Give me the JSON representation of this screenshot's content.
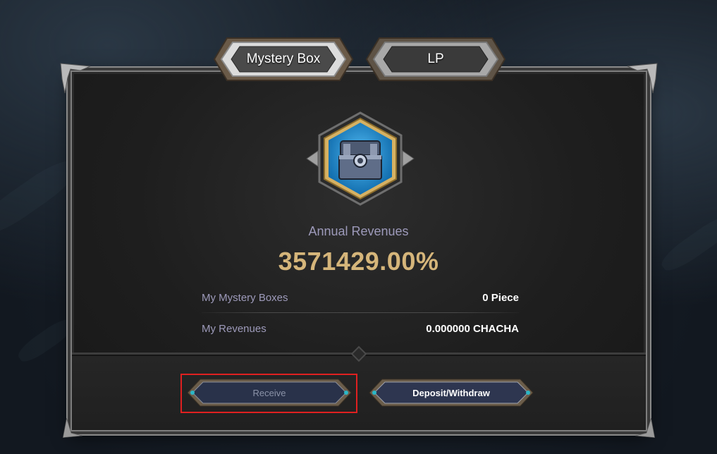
{
  "tabs": [
    {
      "label": "Mystery Box",
      "active": true
    },
    {
      "label": "LP",
      "active": false
    }
  ],
  "icon": "mystery-box-chest-icon",
  "revenue": {
    "label": "Annual Revenues",
    "value": "3571429.00%"
  },
  "stats": [
    {
      "key": "My Mystery Boxes",
      "value": "0 Piece"
    },
    {
      "key": "My Revenues",
      "value": "0.000000 CHACHA"
    }
  ],
  "buttons": {
    "receive": "Receive",
    "deposit": "Deposit/Withdraw"
  },
  "colors": {
    "accent_gold": "#d5b57a",
    "label_purple": "#9d9aba",
    "highlight_red": "#e02020",
    "icon_blue": "#1f9fe8"
  }
}
